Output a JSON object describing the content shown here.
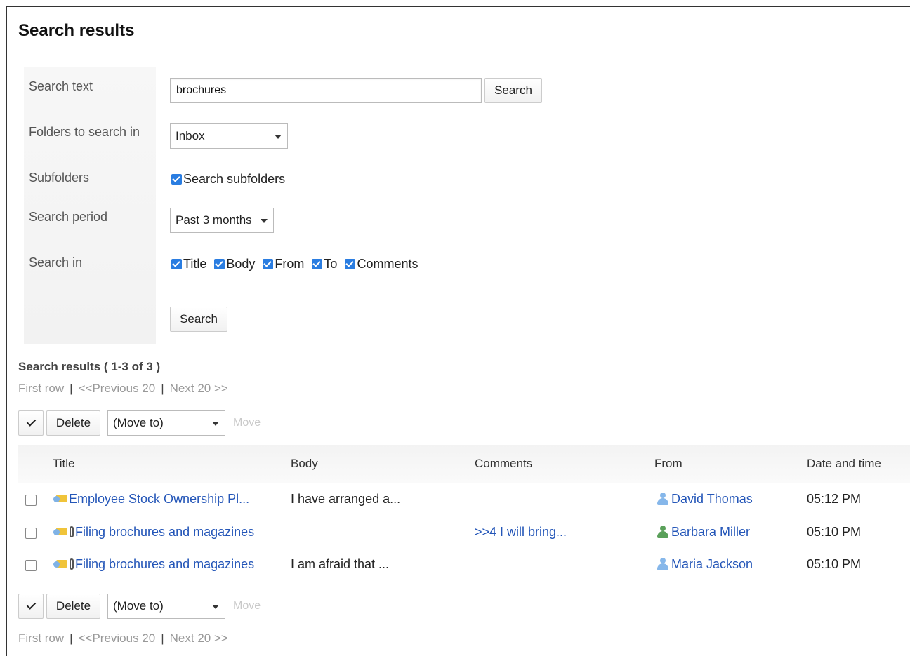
{
  "page": {
    "title": "Search results"
  },
  "form": {
    "search_text_label": "Search text",
    "search_text_value": "brochures",
    "search_button": "Search",
    "folders_label": "Folders to search in",
    "folder_selected": "Inbox",
    "subfolders_label": "Subfolders",
    "subfolders_checkbox": "Search subfolders",
    "period_label": "Search period",
    "period_selected": "Past 3 months",
    "search_in_label": "Search in",
    "search_in_options": [
      "Title",
      "Body",
      "From",
      "To",
      "Comments"
    ],
    "search_button_bottom": "Search"
  },
  "results": {
    "header": "Search results ( 1-3 of 3 )",
    "pager": {
      "first": "First row",
      "prev": "<<Previous 20",
      "next": "Next 20 >>"
    },
    "toolbar": {
      "delete": "Delete",
      "move_to": "(Move to)",
      "move": "Move"
    },
    "columns": [
      "Title",
      "Body",
      "Comments",
      "From",
      "Date and time"
    ],
    "rows": [
      {
        "title": "Employee Stock Ownership Pl...",
        "attachment": false,
        "body": "I have arranged a...",
        "comments": "",
        "from": "David Thomas",
        "from_icon": "user-blue-icon",
        "time": "05:12 PM"
      },
      {
        "title": "Filing brochures and magazines",
        "attachment": true,
        "body": "",
        "comments": ">>4 I will bring...",
        "from": "Barbara Miller",
        "from_icon": "user-green-icon",
        "time": "05:10 PM"
      },
      {
        "title": "Filing brochures and magazines",
        "attachment": true,
        "body": "I am afraid that ...",
        "comments": "",
        "from": "Maria Jackson",
        "from_icon": "user-blue-icon",
        "time": "05:10 PM"
      }
    ]
  },
  "colors": {
    "link": "#2456b8",
    "checkbox": "#2a7de1",
    "label_bg": "#f4f4f4"
  }
}
